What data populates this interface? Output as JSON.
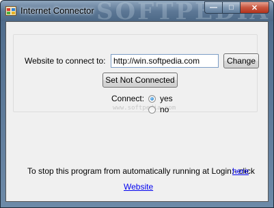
{
  "window": {
    "title": "Internet Connector",
    "watermark": "SOFTPEDIA",
    "caption": {
      "minimize": "—",
      "maximize": "□",
      "close": "✕"
    }
  },
  "form": {
    "website_label": "Website to connect to:",
    "website_value": "http://win.softpedia.com",
    "change_button": "Change",
    "set_not_connected_button": "Set Not Connected",
    "connect_label": "Connect:",
    "options": [
      {
        "label": "yes",
        "checked": true
      },
      {
        "label": "no",
        "checked": false
      }
    ],
    "faint_watermark": "www.softpedia.com"
  },
  "footer": {
    "stop_text": "To stop this program from automatically running at Login:- click",
    "here_link": "here",
    "website_link": "Website"
  },
  "colors": {
    "title_gradient": "#5d7896",
    "close_button": "#c8563f",
    "link": "#0000ee",
    "radio_selected": "#1b6fb8"
  }
}
